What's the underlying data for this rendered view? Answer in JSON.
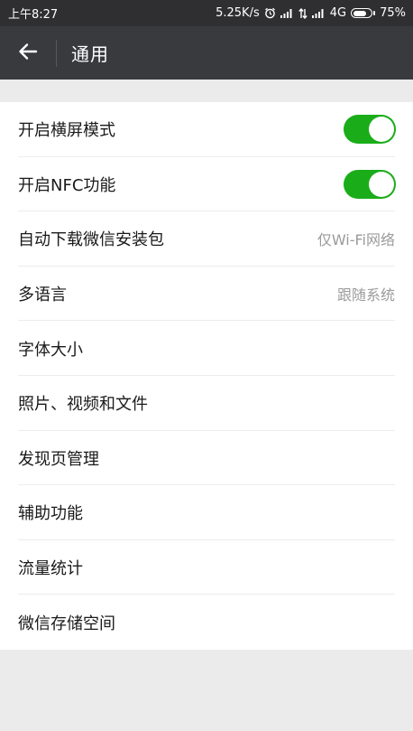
{
  "status_bar": {
    "time": "上午8:27",
    "net_speed": "5.25K/s",
    "network_type": "4G",
    "battery": "75%",
    "battery_level": 0.75,
    "icons": [
      "alarm-icon",
      "signal-icon",
      "data-transfer-icon",
      "signal-icon",
      "battery-icon"
    ]
  },
  "header": {
    "title": "通用",
    "back_icon": "arrow-left-icon"
  },
  "settings": {
    "items": [
      {
        "label": "开启横屏模式",
        "toggle": true
      },
      {
        "label": "开启NFC功能",
        "toggle": true
      },
      {
        "label": "自动下载微信安装包",
        "value": "仅Wi-Fi网络"
      },
      {
        "label": "多语言",
        "value": "跟随系统"
      },
      {
        "label": "字体大小"
      },
      {
        "label": "照片、视频和文件"
      },
      {
        "label": "发现页管理"
      },
      {
        "label": "辅助功能"
      },
      {
        "label": "流量统计"
      },
      {
        "label": "微信存储空间"
      }
    ]
  },
  "colors": {
    "toggle_on": "#1aad19",
    "header_bg": "#383a3e",
    "status_bg": "#2f2f31",
    "page_bg": "#ebebeb"
  }
}
